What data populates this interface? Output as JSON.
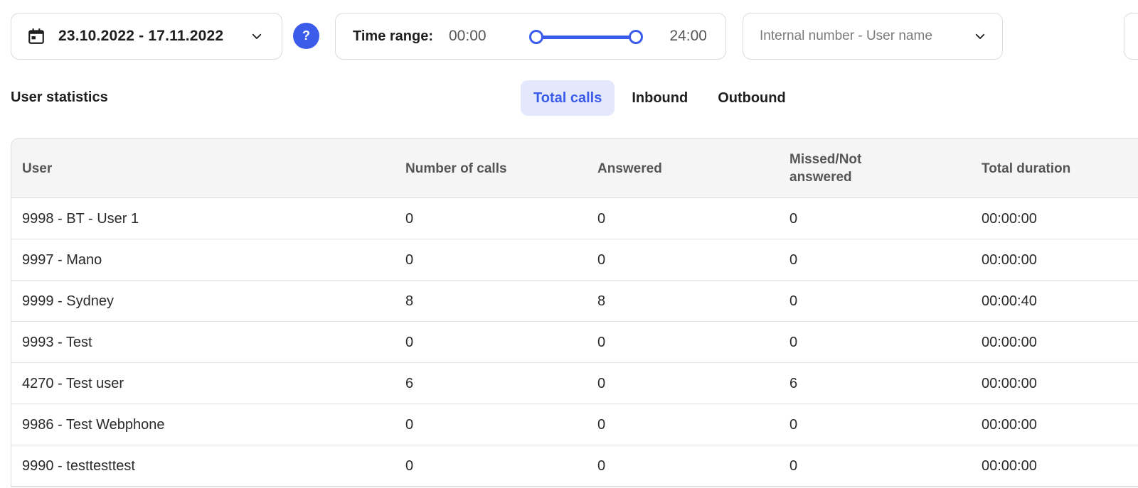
{
  "filters": {
    "date_range": "23.10.2022 - 17.11.2022",
    "help": "?",
    "time_range_label": "Time range:",
    "time_start": "00:00",
    "time_end": "24:00",
    "user_placeholder": "Internal number - User name"
  },
  "section_title": "User statistics",
  "tabs": [
    {
      "label": "Total calls",
      "active": true
    },
    {
      "label": "Inbound",
      "active": false
    },
    {
      "label": "Outbound",
      "active": false
    }
  ],
  "table": {
    "columns": [
      "User",
      "Number of calls",
      "Answered",
      "Missed/Not answered",
      "Total duration"
    ],
    "rows": [
      [
        "9998 - BT - User 1",
        "0",
        "0",
        "0",
        "00:00:00"
      ],
      [
        "9997 - Mano",
        "0",
        "0",
        "0",
        "00:00:00"
      ],
      [
        "9999 - Sydney",
        "8",
        "8",
        "0",
        "00:00:40"
      ],
      [
        "9993 - Test",
        "0",
        "0",
        "0",
        "00:00:00"
      ],
      [
        "4270 - Test user",
        "6",
        "0",
        "6",
        "00:00:00"
      ],
      [
        "9986 - Test Webphone",
        "0",
        "0",
        "0",
        "00:00:00"
      ],
      [
        "9990 - testtesttest",
        "0",
        "0",
        "0",
        "00:00:00"
      ]
    ]
  },
  "colors": {
    "accent": "#3b5bea",
    "tab_active_bg": "#e3e8fd"
  }
}
